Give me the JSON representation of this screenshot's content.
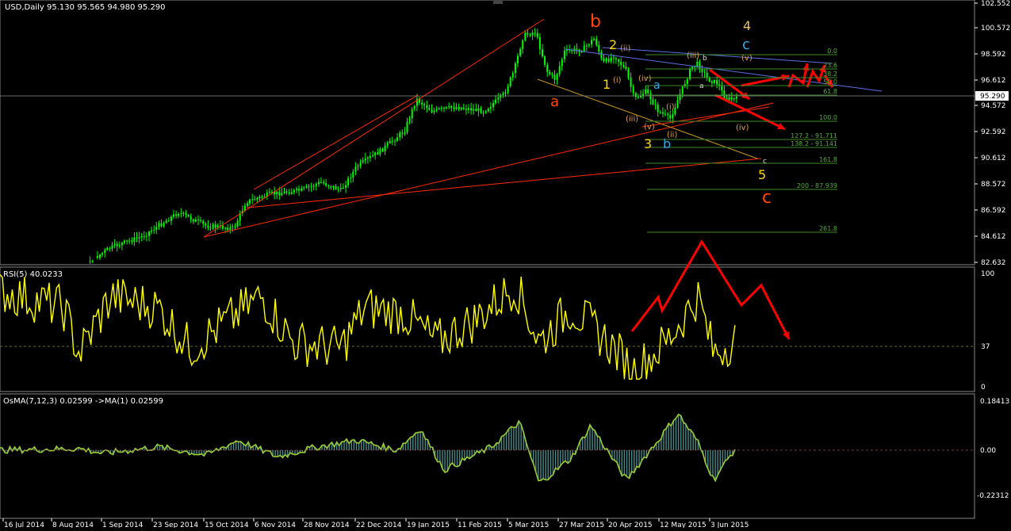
{
  "window": {
    "title": "USD,Daily  95.130 95.565 94.980 95.290",
    "price_tag": "95.290",
    "colors": {
      "bg": "#000000",
      "candle": "#00ff00",
      "rsi": "#ffff00",
      "osma_line": "#9acd32",
      "osma_hist": "#4a8a8a",
      "trend": "#ff2a00",
      "wave_arrow": "#ff0000",
      "fib": "#53ae3a",
      "grid": "#ffffff"
    }
  },
  "price_axis": [
    "102.552",
    "100.572",
    "98.592",
    "96.612",
    "94.572",
    "92.592",
    "90.612",
    "88.572",
    "86.592",
    "84.612",
    "82.632"
  ],
  "time_axis": [
    "16 Jul 2014",
    "8 Aug 2014",
    "1 Sep 2014",
    "23 Sep 2014",
    "15 Oct 2014",
    "6 Nov 2014",
    "28 Nov 2014",
    "22 Dec 2014",
    "19 Jan 2015",
    "11 Feb 2015",
    "5 Mar 2015",
    "27 Mar 2015",
    "20 Apr 2015",
    "12 May 2015",
    "3 Jun 2015"
  ],
  "fib_labels": [
    "0.0",
    "23.6",
    "38.2",
    "50.0",
    "61.8",
    "100.0",
    "127.2 - 91.711",
    "138.2 - 91.141",
    "161.8",
    "200 - 87.939",
    "261.8"
  ],
  "wave_labels": {
    "b_big": "b",
    "a_big": "a",
    "c_big": "c",
    "w4": "4",
    "c_blue": "c",
    "a_blue": "a",
    "b_blue": "b",
    "w2": "2",
    "w1": "1",
    "w3": "3",
    "w5": "5",
    "ii": "(ii)",
    "i": "(i)",
    "iv": "(iv)",
    "iii": "(iii)",
    "v": "(v)",
    "iii2": "(iii)",
    "v2": "(v)",
    "i2": "(i)",
    "ii2": "(ii)",
    "iv2": "(iv)",
    "small_b": "b",
    "small_a": "a",
    "small_c": "c"
  },
  "rsi": {
    "title": "RSI(5) 40.0233",
    "levels": [
      "100",
      "37",
      "0"
    ]
  },
  "osma": {
    "title": "OsMA(7,12,3) 0.02599  ->MA(1) 0.02599",
    "levels": [
      "0.18413",
      "0.00",
      "-0.22312"
    ]
  }
}
